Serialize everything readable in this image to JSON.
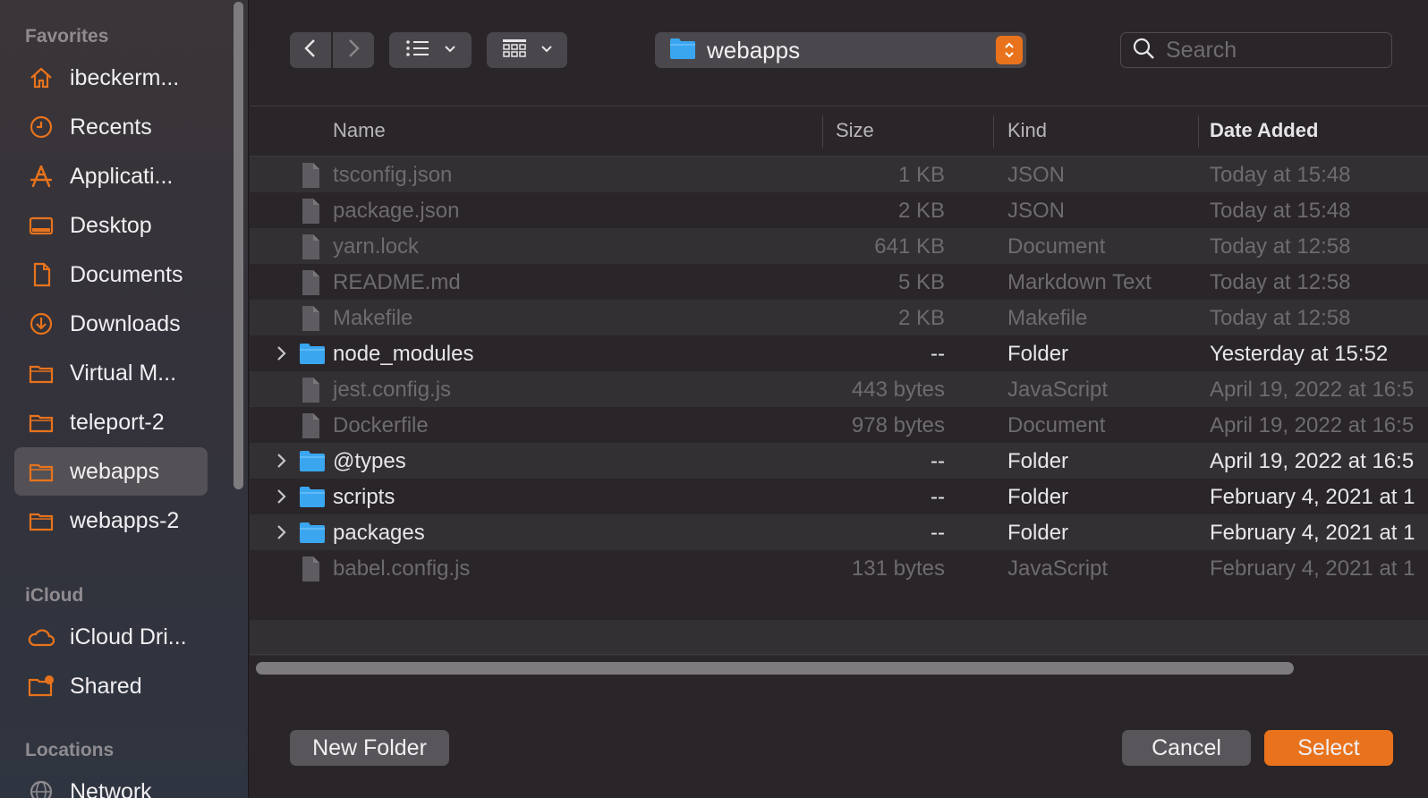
{
  "sidebar": {
    "favorites_title": "Favorites",
    "favorites": [
      {
        "label": "ibeckerm...",
        "icon": "home-icon"
      },
      {
        "label": "Recents",
        "icon": "clock-icon"
      },
      {
        "label": "Applicati...",
        "icon": "applications-icon"
      },
      {
        "label": "Desktop",
        "icon": "desktop-icon"
      },
      {
        "label": "Documents",
        "icon": "document-icon"
      },
      {
        "label": "Downloads",
        "icon": "download-icon"
      },
      {
        "label": "Virtual M...",
        "icon": "folder-icon"
      },
      {
        "label": "teleport-2",
        "icon": "folder-icon"
      },
      {
        "label": "webapps",
        "icon": "folder-icon",
        "selected": true
      },
      {
        "label": "webapps-2",
        "icon": "folder-icon"
      }
    ],
    "icloud_title": "iCloud",
    "icloud": [
      {
        "label": "iCloud Dri...",
        "icon": "cloud-icon"
      },
      {
        "label": "Shared",
        "icon": "shared-folder-icon"
      }
    ],
    "locations_title": "Locations",
    "locations": [
      {
        "label": "Network",
        "icon": "globe-icon"
      }
    ]
  },
  "toolbar": {
    "path": "webapps",
    "search_placeholder": "Search"
  },
  "columns": {
    "name": "Name",
    "size": "Size",
    "kind": "Kind",
    "date": "Date Added"
  },
  "files": [
    {
      "name": "tsconfig.json",
      "size": "1 KB",
      "kind": "JSON",
      "date": "Today at 15:48",
      "folder": false
    },
    {
      "name": "package.json",
      "size": "2 KB",
      "kind": "JSON",
      "date": "Today at 15:48",
      "folder": false
    },
    {
      "name": "yarn.lock",
      "size": "641 KB",
      "kind": "Document",
      "date": "Today at 12:58",
      "folder": false
    },
    {
      "name": "README.md",
      "size": "5 KB",
      "kind": "Markdown Text",
      "date": "Today at 12:58",
      "folder": false
    },
    {
      "name": "Makefile",
      "size": "2 KB",
      "kind": "Makefile",
      "date": "Today at 12:58",
      "folder": false
    },
    {
      "name": "node_modules",
      "size": "--",
      "kind": "Folder",
      "date": "Yesterday at 15:52",
      "folder": true
    },
    {
      "name": "jest.config.js",
      "size": "443 bytes",
      "kind": "JavaScript",
      "date": "April 19, 2022 at 16:5",
      "folder": false
    },
    {
      "name": "Dockerfile",
      "size": "978 bytes",
      "kind": "Document",
      "date": "April 19, 2022 at 16:5",
      "folder": false
    },
    {
      "name": "@types",
      "size": "--",
      "kind": "Folder",
      "date": "April 19, 2022 at 16:5",
      "folder": true
    },
    {
      "name": "scripts",
      "size": "--",
      "kind": "Folder",
      "date": "February 4, 2021 at 1",
      "folder": true
    },
    {
      "name": "packages",
      "size": "--",
      "kind": "Folder",
      "date": "February 4, 2021 at 1",
      "folder": true
    },
    {
      "name": "babel.config.js",
      "size": "131 bytes",
      "kind": "JavaScript",
      "date": "February 4, 2021 at 1",
      "folder": false
    }
  ],
  "buttons": {
    "new_folder": "New Folder",
    "cancel": "Cancel",
    "select": "Select"
  },
  "colors": {
    "accent": "#e8731c",
    "folder_blue": "#3aa6f0"
  }
}
